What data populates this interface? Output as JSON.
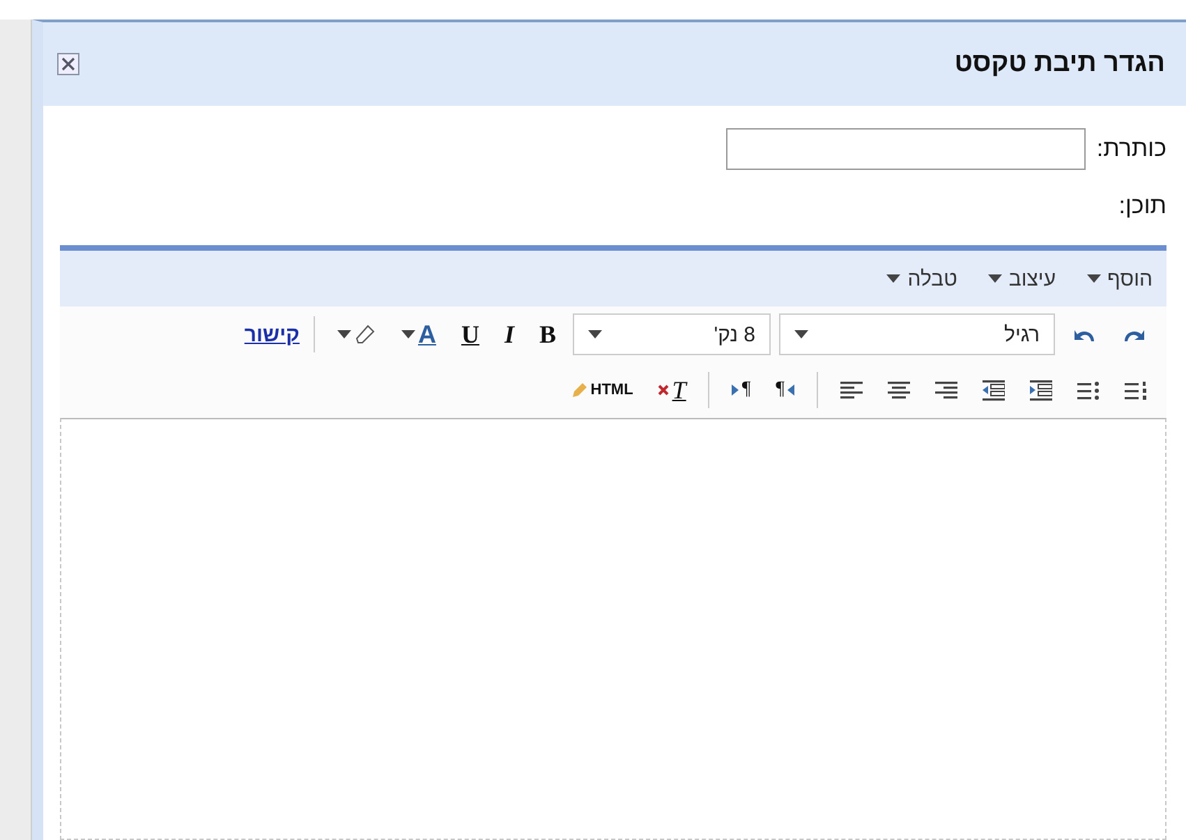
{
  "dialog": {
    "title": "הגדר תיבת טקסט"
  },
  "title_field": {
    "label": "כותרת:"
  },
  "content": {
    "label": "תוכן:"
  },
  "editor": {
    "menus": [
      "הוסף",
      "עיצוב",
      "טבלה"
    ],
    "toolbar_1": [
      {
        "kind": "redo"
      },
      {
        "kind": "undo"
      },
      {
        "kind": "style-select",
        "text": "רגיל"
      },
      {
        "kind": "size-select",
        "text": "8 נק'"
      },
      {
        "kind": "bold",
        "text": "B"
      },
      {
        "kind": "italic",
        "text": "I"
      },
      {
        "kind": "underline",
        "text": "U"
      },
      {
        "kind": "text-color",
        "text": "A"
      },
      {
        "kind": "highlight"
      },
      {
        "kind": "separator"
      },
      {
        "kind": "link",
        "text": "קישור"
      }
    ],
    "toolbar_2": [
      {
        "kind": "numbered-list"
      },
      {
        "kind": "bullet-list"
      },
      {
        "kind": "indent"
      },
      {
        "kind": "outdent"
      },
      {
        "kind": "align-right"
      },
      {
        "kind": "align-center"
      },
      {
        "kind": "align-left"
      },
      {
        "kind": "separator"
      },
      {
        "kind": "rtl",
        "text": "¶"
      },
      {
        "kind": "ltr",
        "text": "¶"
      },
      {
        "kind": "separator"
      },
      {
        "kind": "clear-format",
        "text": "T"
      },
      {
        "kind": "html",
        "text": "HTML"
      }
    ]
  }
}
